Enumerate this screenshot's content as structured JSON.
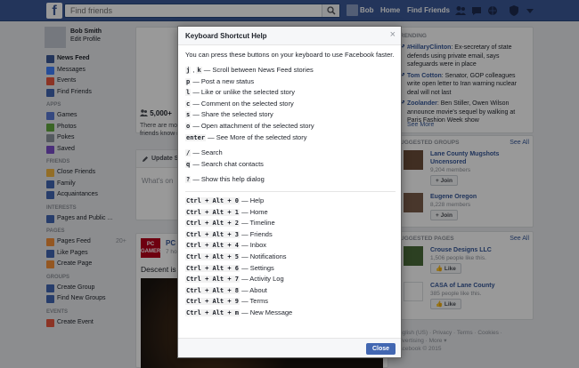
{
  "topbar": {
    "search_placeholder": "Find friends",
    "user_name": "Bob",
    "home_label": "Home",
    "find_friends_label": "Find Friends"
  },
  "profile": {
    "name": "Bob Smith",
    "edit_label": "Edit Profile"
  },
  "leftnav": {
    "favorites": [
      {
        "label": "News Feed",
        "color": "#3b5998"
      },
      {
        "label": "Messages",
        "color": "#4080ff"
      },
      {
        "label": "Events",
        "color": "#e9573f"
      },
      {
        "label": "Find Friends",
        "color": "#4267b2"
      }
    ],
    "apps_header": "APPS",
    "apps": [
      {
        "label": "Games",
        "color": "#5b7bd5"
      },
      {
        "label": "Photos",
        "color": "#62a83e"
      },
      {
        "label": "Pokes",
        "color": "#8d949e"
      },
      {
        "label": "Saved",
        "color": "#7c4dcc"
      }
    ],
    "friends_header": "FRIENDS",
    "friends": [
      {
        "label": "Close Friends",
        "color": "#f5b842"
      },
      {
        "label": "Family",
        "color": "#4267b2"
      },
      {
        "label": "Acquaintances",
        "color": "#4267b2"
      }
    ],
    "interests_header": "INTERESTS",
    "interests": [
      {
        "label": "Pages and Public ...",
        "color": "#4267b2"
      }
    ],
    "pages_header": "PAGES",
    "pages": [
      {
        "label": "Pages Feed",
        "count": "20+",
        "color": "#f7923a"
      },
      {
        "label": "Like Pages",
        "color": "#4267b2"
      },
      {
        "label": "Create Page",
        "color": "#f7923a"
      }
    ],
    "groups_header": "GROUPS",
    "groups": [
      {
        "label": "Create Group",
        "color": "#4267b2"
      },
      {
        "label": "Find New Groups",
        "color": "#4267b2"
      }
    ],
    "events_header": "EVENTS",
    "events": [
      {
        "label": "Create Event",
        "color": "#e9573f"
      }
    ]
  },
  "feed": {
    "friends_count": "5,000+",
    "friends_text_1": "There are more",
    "friends_text_2": "friends know it",
    "update_label": "Update S",
    "whats_on_mind": "What's on",
    "post_author": "PC",
    "post_logo": "PC GAMER",
    "post_time": "7 hours",
    "post_text": "Descent is"
  },
  "right": {
    "trending_header": "RENDING",
    "trends": [
      {
        "title": "#HillaryClinton",
        "text": ": Ex-secretary of state defends using private email, says safeguards were in place"
      },
      {
        "title": "Tom Cotton",
        "text": ": Senator, GOP colleagues write open letter to Iran warning nuclear deal will not last"
      },
      {
        "title": "Zoolander",
        "text": ": Ben Stiller, Owen Wilson announce movie's sequel by walking at Paris Fashion Week show"
      }
    ],
    "see_more": "See More",
    "groups_header": "UGGESTED GROUPS",
    "see_all": "See All",
    "groups": [
      {
        "title": "Lane County Mugshots Uncensored",
        "members": "9,204 members",
        "join": "Join"
      },
      {
        "title": "Eugene Oregon",
        "members": "8,228 members",
        "join": "Join"
      }
    ],
    "pages_header": "UGGESTED PAGES",
    "pages": [
      {
        "title": "Crouse Designs LLC",
        "likes": "1,506 people like this.",
        "like": "Like"
      },
      {
        "title": "CASA of Lane County",
        "likes": "385 people like this.",
        "like": "Like"
      }
    ],
    "footer_1": "nglish (US) · Privacy · Terms · Cookies ·",
    "footer_2": "dvertising · More ▾",
    "footer_3": "acebook © 2015"
  },
  "dialog": {
    "title": "Keyboard Shortcut Help",
    "close_x": "×",
    "intro": "You can press these buttons on your keyboard to use Facebook faster.",
    "shortcuts": [
      {
        "keys": [
          "j",
          "k"
        ],
        "desc": "— Scroll between News Feed stories"
      },
      {
        "keys": [
          "p"
        ],
        "desc": "— Post a new status"
      },
      {
        "keys": [
          "l"
        ],
        "desc": "— Like or unlike the selected story"
      },
      {
        "keys": [
          "c"
        ],
        "desc": "— Comment on the selected story"
      },
      {
        "keys": [
          "s"
        ],
        "desc": "— Share the selected story"
      },
      {
        "keys": [
          "o"
        ],
        "desc": "— Open attachment of the selected story"
      },
      {
        "keys": [
          "enter"
        ],
        "desc": "— See More of the selected story"
      }
    ],
    "search_shortcuts": [
      {
        "keys": [
          "/"
        ],
        "desc": "— Search"
      },
      {
        "keys": [
          "q"
        ],
        "desc": "— Search chat contacts"
      }
    ],
    "help_shortcut": {
      "keys": [
        "?"
      ],
      "desc": "— Show this help dialog"
    },
    "nav_shortcuts": [
      {
        "keys": "Ctrl + Alt + 0",
        "desc": "— Help"
      },
      {
        "keys": "Ctrl + Alt + 1",
        "desc": "— Home"
      },
      {
        "keys": "Ctrl + Alt + 2",
        "desc": "— Timeline"
      },
      {
        "keys": "Ctrl + Alt + 3",
        "desc": "— Friends"
      },
      {
        "keys": "Ctrl + Alt + 4",
        "desc": "— Inbox"
      },
      {
        "keys": "Ctrl + Alt + 5",
        "desc": "— Notifications"
      },
      {
        "keys": "Ctrl + Alt + 6",
        "desc": "— Settings"
      },
      {
        "keys": "Ctrl + Alt + 7",
        "desc": "— Activity Log"
      },
      {
        "keys": "Ctrl + Alt + 8",
        "desc": "— About"
      },
      {
        "keys": "Ctrl + Alt + 9",
        "desc": "— Terms"
      },
      {
        "keys": "Ctrl + Alt + m",
        "desc": "— New Message"
      }
    ],
    "close_label": "Close"
  }
}
